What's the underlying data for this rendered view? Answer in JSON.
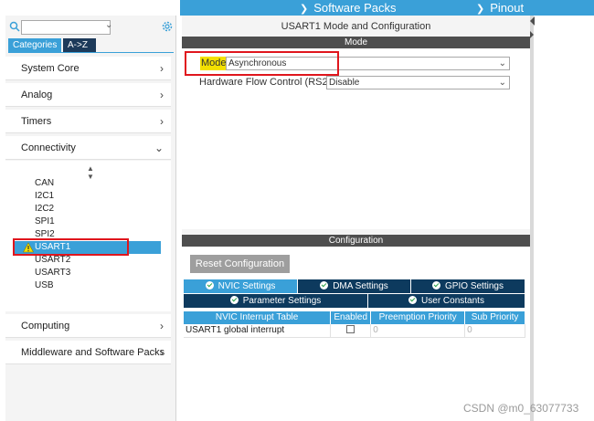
{
  "topbar": {
    "software_packs": "Software Packs",
    "pinout": "Pinout"
  },
  "left": {
    "search": {
      "value": ""
    },
    "tabs": [
      "Categories",
      "A->Z"
    ],
    "categories": {
      "system_core": "System Core",
      "analog": "Analog",
      "timers": "Timers",
      "connectivity": "Connectivity",
      "computing": "Computing",
      "middleware": "Middleware and Software Packs"
    },
    "connectivity_items": [
      "CAN",
      "I2C1",
      "I2C2",
      "SPI1",
      "SPI2",
      "USART1",
      "USART2",
      "USART3",
      "USB"
    ],
    "selected": "USART1"
  },
  "center": {
    "title": "USART1 Mode and Configuration",
    "mode_bar": "Mode",
    "mode_label": "Mode",
    "mode_value": "Asynchronous",
    "flow_label": "Hardware Flow Control (RS232)",
    "flow_value": "Disable",
    "config_bar": "Configuration",
    "reset_button": "Reset Configuration",
    "tabs": {
      "nvic": "NVIC Settings",
      "dma": "DMA Settings",
      "gpio": "GPIO Settings",
      "param": "Parameter Settings",
      "user": "User Constants"
    },
    "table": {
      "headers": [
        "NVIC Interrupt Table",
        "Enabled",
        "Preemption Priority",
        "Sub Priority"
      ],
      "rows": [
        {
          "name": "USART1 global interrupt",
          "enabled": false,
          "preemption": "0",
          "sub": "0"
        }
      ]
    }
  },
  "watermark": "CSDN @m0_63077733",
  "colors": {
    "accent": "#3aa0d8",
    "dark_tab": "#0d3a5e",
    "section_bar": "#4e4e4e",
    "highlight": "#f3e000",
    "annotation_red": "#e0161d"
  }
}
